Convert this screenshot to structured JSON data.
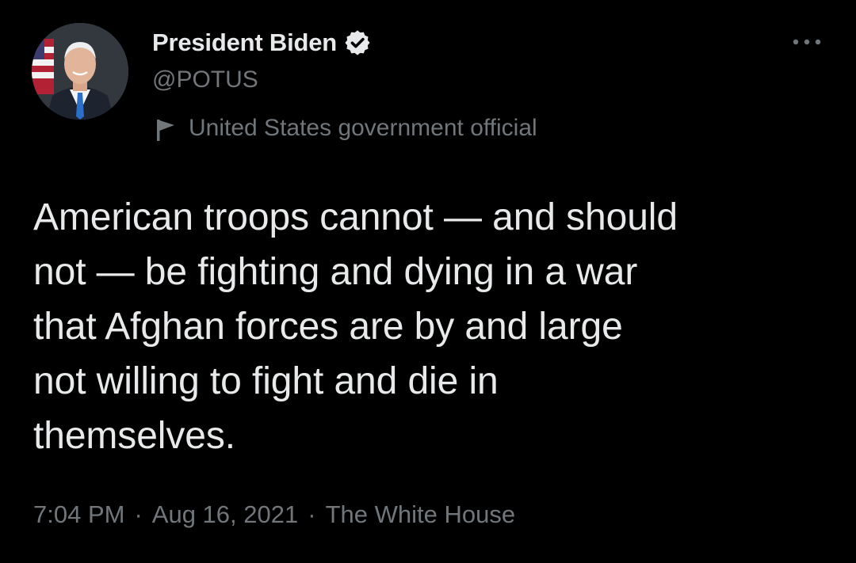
{
  "colors": {
    "background": "#000000",
    "text_primary": "#e7e9ea",
    "text_secondary": "#71767b"
  },
  "author": {
    "display_name": "President Biden",
    "handle": "@POTUS",
    "verified": true,
    "avatar_icon": "profile-photo",
    "label": "United States government official",
    "label_icon": "flag-icon"
  },
  "menu": {
    "icon": "more-horizontal-icon"
  },
  "tweet": {
    "text": "American troops cannot — and should\nnot — be fighting and dying in a war\nthat Afghan forces are by and large\nnot willing to fight and die in\nthemselves.",
    "time": "7:04 PM",
    "date": "Aug 16, 2021",
    "source": "The White House",
    "separator": "·"
  }
}
